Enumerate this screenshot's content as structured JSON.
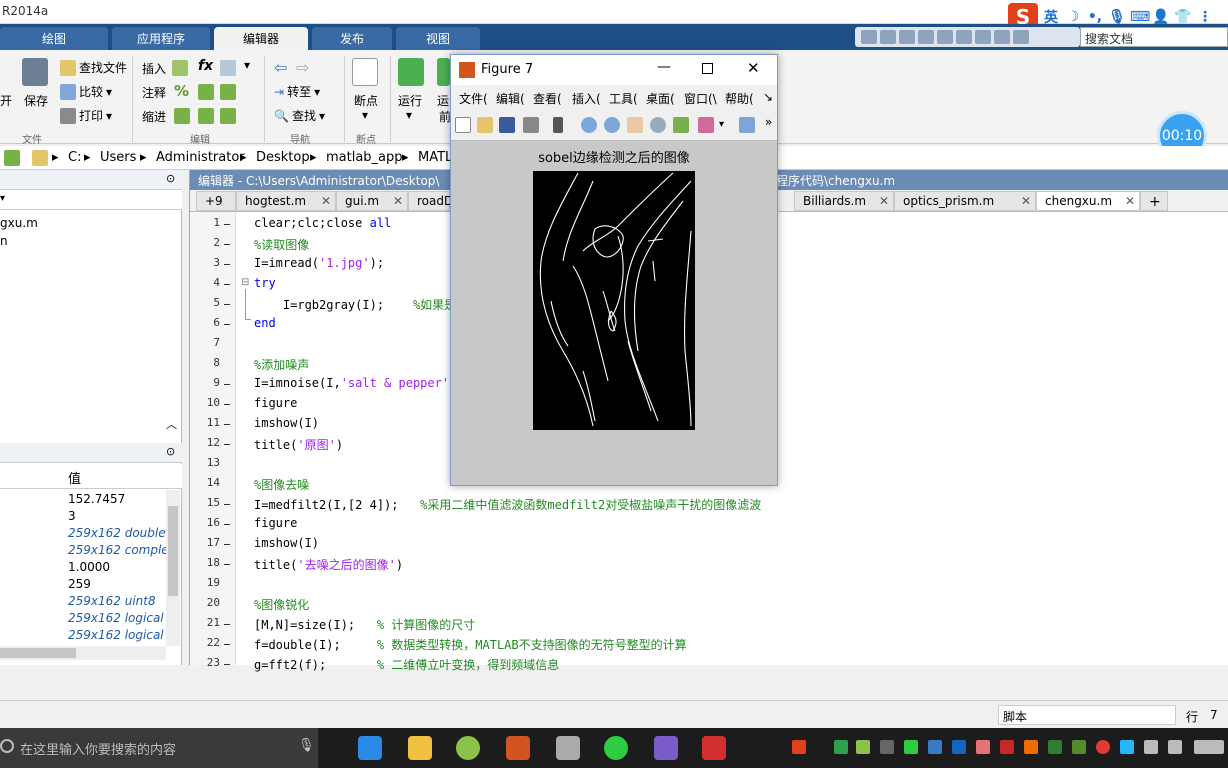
{
  "window_title": "R2014a",
  "ime": {
    "logo": "S",
    "mode": "英",
    "glyphs": [
      "☽",
      "•,",
      "🎙",
      "⌨",
      "👤",
      "👕",
      "⋮"
    ]
  },
  "ribbon_tabs": [
    "绘图",
    "应用程序",
    "编辑器",
    "发布",
    "视图"
  ],
  "search_docs_placeholder": "搜索文档",
  "ribbon": {
    "partial_left": "开",
    "save": "保存",
    "file_group": "文件",
    "find_files": "查找文件",
    "compare": "比较",
    "print": "打印",
    "insert": "插入",
    "comment": "注释",
    "indent": "缩进",
    "fx": "fx",
    "percent": "%",
    "edit_group": "编辑",
    "goto": "转至",
    "find": "查找",
    "nav_group": "导航",
    "breakpoints": "断点",
    "bp_group": "断点",
    "run": "运行",
    "run_adv_partial": "运",
    "run_adv_partial2": "前"
  },
  "timer": "00:10",
  "address": [
    "C:",
    "Users",
    "Administrator",
    "Desktop",
    "matlab_app",
    "MATL"
  ],
  "workspace": {
    "file_partial": "gxu.m",
    "value_header": "值",
    "values": [
      {
        "text": "152.7457",
        "italic": false
      },
      {
        "text": "3",
        "italic": false
      },
      {
        "text": "259x162 double",
        "italic": true
      },
      {
        "text": "259x162 comple",
        "italic": true
      },
      {
        "text": "1.0000",
        "italic": false
      },
      {
        "text": "259",
        "italic": false
      },
      {
        "text": "259x162 uint8",
        "italic": true
      },
      {
        "text": "259x162 logical",
        "italic": true
      },
      {
        "text": "259x162 logical",
        "italic": true
      }
    ]
  },
  "editor": {
    "title": "编辑器 - C:\\Users\\Administrator\\Desktop\\",
    "title_right": "程序代码\\chengxu.m",
    "tabs": [
      "+9",
      "hogtest.m",
      "gui.m",
      "roadD",
      "Billiards.m",
      "optics_prism.m",
      "chengxu.m"
    ],
    "lines": [
      {
        "n": "1",
        "d": true,
        "segs": [
          [
            "",
            "clear;clc;close "
          ],
          [
            "kw",
            "all"
          ]
        ]
      },
      {
        "n": "2",
        "d": true,
        "segs": [
          [
            "cm",
            "%读取图像"
          ]
        ]
      },
      {
        "n": "3",
        "d": true,
        "segs": [
          [
            "",
            "I=imread("
          ],
          [
            "st",
            "'1.jpg'"
          ],
          [
            "",
            ");"
          ]
        ]
      },
      {
        "n": "4",
        "d": true,
        "segs": [
          [
            "kw",
            "try"
          ]
        ]
      },
      {
        "n": "5",
        "d": true,
        "segs": [
          [
            "",
            "    I=rgb2gray(I);    "
          ],
          [
            "cm",
            "%如果是"
          ]
        ]
      },
      {
        "n": "6",
        "d": true,
        "segs": [
          [
            "kw",
            "end"
          ]
        ]
      },
      {
        "n": "7",
        "d": false,
        "segs": []
      },
      {
        "n": "8",
        "d": false,
        "segs": [
          [
            "cm",
            "%添加噪声"
          ]
        ]
      },
      {
        "n": "9",
        "d": true,
        "segs": [
          [
            "",
            "I=imnoise(I,"
          ],
          [
            "st",
            "'salt & pepper'"
          ],
          [
            "",
            ","
          ]
        ]
      },
      {
        "n": "10",
        "d": true,
        "segs": [
          [
            "",
            "figure"
          ]
        ]
      },
      {
        "n": "11",
        "d": true,
        "segs": [
          [
            "",
            "imshow(I)"
          ]
        ]
      },
      {
        "n": "12",
        "d": true,
        "segs": [
          [
            "",
            "title("
          ],
          [
            "st",
            "'原图'"
          ],
          [
            "",
            ")"
          ]
        ]
      },
      {
        "n": "13",
        "d": false,
        "segs": []
      },
      {
        "n": "14",
        "d": false,
        "segs": [
          [
            "cm",
            "%图像去噪"
          ]
        ]
      },
      {
        "n": "15",
        "d": true,
        "segs": [
          [
            "",
            "I=medfilt2(I,[2 4]);   "
          ],
          [
            "cm",
            "%采用二维中值滤波函数medfilt2对受椒盐噪声干扰的图像滤波"
          ]
        ]
      },
      {
        "n": "16",
        "d": true,
        "segs": [
          [
            "",
            "figure"
          ]
        ]
      },
      {
        "n": "17",
        "d": true,
        "segs": [
          [
            "",
            "imshow(I)"
          ]
        ]
      },
      {
        "n": "18",
        "d": true,
        "segs": [
          [
            "",
            "title("
          ],
          [
            "st",
            "'去噪之后的图像'"
          ],
          [
            "",
            ")"
          ]
        ]
      },
      {
        "n": "19",
        "d": false,
        "segs": []
      },
      {
        "n": "20",
        "d": false,
        "segs": [
          [
            "cm",
            "%图像锐化"
          ]
        ]
      },
      {
        "n": "21",
        "d": true,
        "segs": [
          [
            "",
            "[M,N]=size(I);   "
          ],
          [
            "cm",
            "% 计算图像的尺寸"
          ]
        ]
      },
      {
        "n": "22",
        "d": true,
        "segs": [
          [
            "",
            "f=double(I);     "
          ],
          [
            "cm",
            "% 数据类型转换，MATLAB不支持图像的无符号整型的计算"
          ]
        ]
      },
      {
        "n": "23",
        "d": true,
        "segs": [
          [
            "",
            "g=fft2(f);       "
          ],
          [
            "cm",
            "% 二维傅立叶变换，得到频域信息"
          ]
        ]
      }
    ]
  },
  "figure": {
    "title": "Figure 7",
    "menus": [
      "文件(",
      "编辑(",
      "查看(",
      "插入(",
      "工具(",
      "桌面(",
      "窗口(\\",
      "帮助(",
      "↘"
    ],
    "plot_title": "sobel边缘检测之后的图像"
  },
  "status": {
    "mode": "脚本",
    "line_label": "行",
    "line_value": "7"
  },
  "taskbar": {
    "search_placeholder": "在这里输入你要搜索的内容"
  }
}
